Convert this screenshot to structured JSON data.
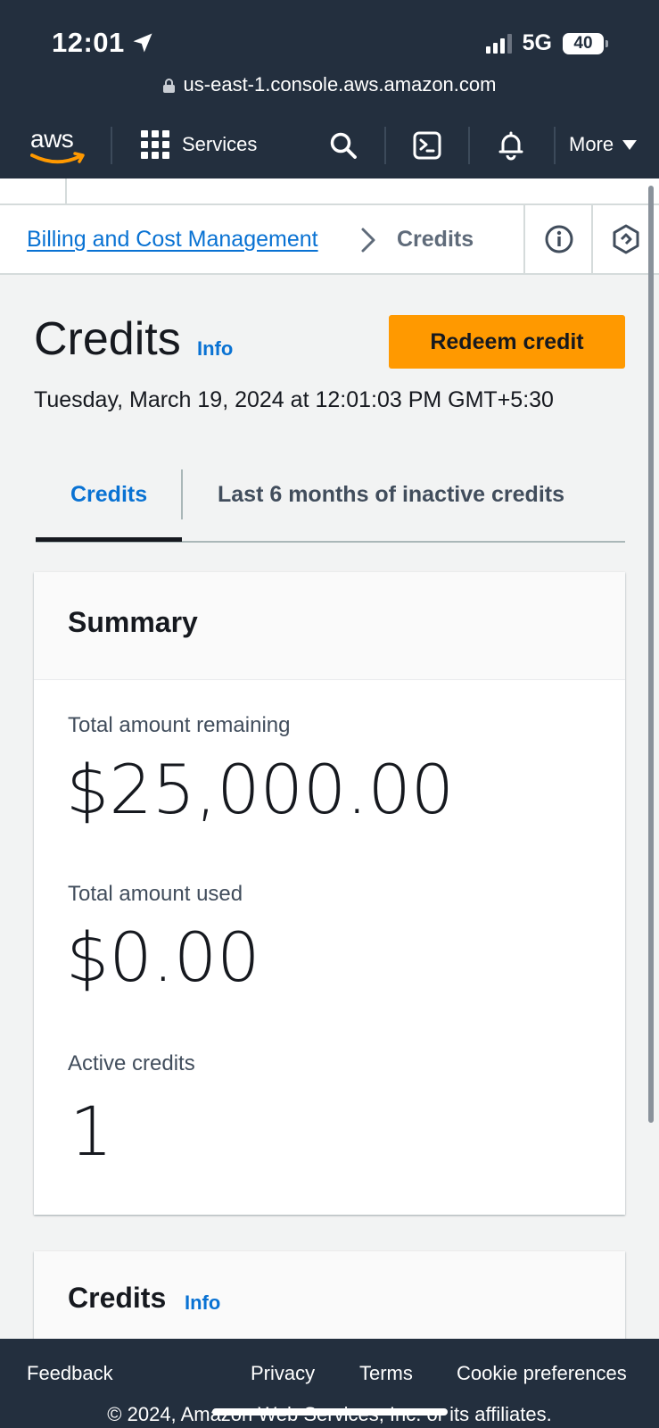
{
  "status_bar": {
    "time": "12:01",
    "network": "5G",
    "battery": "40"
  },
  "browser": {
    "url": "us-east-1.console.aws.amazon.com"
  },
  "aws_nav": {
    "logo": "aws",
    "services_label": "Services",
    "more_label": "More"
  },
  "breadcrumb": {
    "parent": "Billing and Cost Management",
    "current": "Credits"
  },
  "header": {
    "title": "Credits",
    "info": "Info",
    "redeem_button": "Redeem credit",
    "timestamp": "Tuesday, March 19, 2024 at 12:01:03 PM GMT+5:30"
  },
  "tabs": [
    {
      "label": "Credits",
      "active": true
    },
    {
      "label": "Last 6 months of inactive credits",
      "active": false
    }
  ],
  "summary": {
    "heading": "Summary",
    "items": [
      {
        "label": "Total amount remaining",
        "value": "$25,000.00"
      },
      {
        "label": "Total amount used",
        "value": "$0.00"
      },
      {
        "label": "Active credits",
        "value": "1"
      }
    ]
  },
  "credits_section": {
    "heading": "Credits",
    "info": "Info"
  },
  "footer": {
    "links": [
      "Feedback",
      "Privacy",
      "Terms",
      "Cookie preferences"
    ],
    "copyright": "© 2024, Amazon Web Services, Inc. or its affiliates."
  },
  "colors": {
    "nav_bg": "#232f3e",
    "link_blue": "#0972d3",
    "primary_button": "#ff9900",
    "page_bg": "#f2f3f3"
  },
  "icons": [
    "location-arrow-icon",
    "signal-icon",
    "lock-icon",
    "grid-icon",
    "search-icon",
    "cloudshell-icon",
    "bell-icon",
    "caret-down-icon",
    "chevron-right-icon",
    "info-circle-icon",
    "hexagon-settings-icon"
  ]
}
